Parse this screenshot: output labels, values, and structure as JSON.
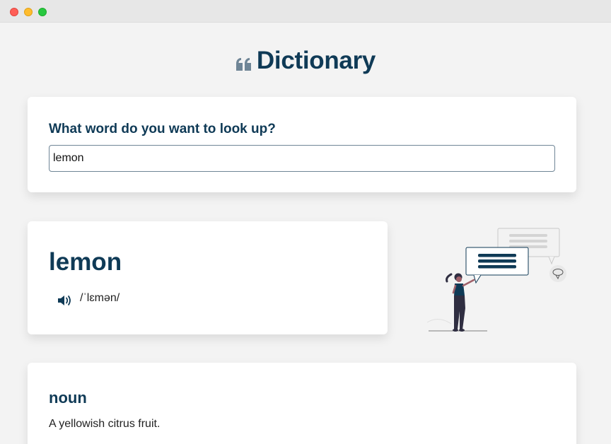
{
  "app": {
    "title": "Dictionary",
    "icon": "quote-icon"
  },
  "search": {
    "question": "What word do you want to look up?",
    "value": "lemon",
    "placeholder": ""
  },
  "result": {
    "word": "lemon",
    "phonetic": "/ˈlɛmən/",
    "audio_icon": "speaker-icon"
  },
  "meanings": [
    {
      "part_of_speech": "noun",
      "definition": "A yellowish citrus fruit."
    }
  ],
  "colors": {
    "primary": "#0f3a56",
    "background": "#f3f3f3",
    "card": "#ffffff",
    "accent_gray": "#6f8596"
  }
}
